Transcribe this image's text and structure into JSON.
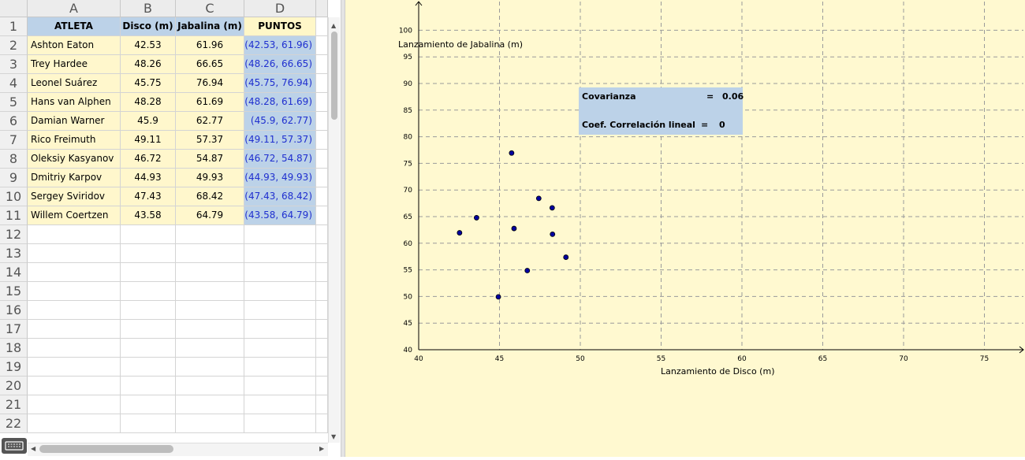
{
  "spreadsheet": {
    "columns": [
      "A",
      "B",
      "C",
      "D"
    ],
    "headers": [
      "ATLETA",
      "Disco (m)",
      "Jabalina (m)",
      "PUNTOS"
    ],
    "row_numbers": [
      "1",
      "2",
      "3",
      "4",
      "5",
      "6",
      "7",
      "8",
      "9",
      "10",
      "11",
      "12",
      "13",
      "14",
      "15",
      "16",
      "17",
      "18",
      "19",
      "20",
      "21",
      "22"
    ],
    "rows": [
      {
        "atleta": "Ashton Eaton",
        "disco": "42.53",
        "jabalina": "61.96",
        "puntos": "(42.53, 61.96)"
      },
      {
        "atleta": "Trey Hardee",
        "disco": "48.26",
        "jabalina": "66.65",
        "puntos": "(48.26, 66.65)"
      },
      {
        "atleta": "Leonel Suárez",
        "disco": "45.75",
        "jabalina": "76.94",
        "puntos": "(45.75, 76.94)"
      },
      {
        "atleta": "Hans van Alphen",
        "disco": "48.28",
        "jabalina": "61.69",
        "puntos": "(48.28, 61.69)"
      },
      {
        "atleta": "Damian Warner",
        "disco": "45.9",
        "jabalina": "62.77",
        "puntos": "(45.9, 62.77)"
      },
      {
        "atleta": "Rico Freimuth",
        "disco": "49.11",
        "jabalina": "57.37",
        "puntos": "(49.11, 57.37)"
      },
      {
        "atleta": "Oleksiy Kasyanov",
        "disco": "46.72",
        "jabalina": "54.87",
        "puntos": "(46.72, 54.87)"
      },
      {
        "atleta": "Dmitriy Karpov",
        "disco": "44.93",
        "jabalina": "49.93",
        "puntos": "(44.93, 49.93)"
      },
      {
        "atleta": "Sergey Sviridov",
        "disco": "47.43",
        "jabalina": "68.42",
        "puntos": "(47.43, 68.42)"
      },
      {
        "atleta": "Willem Coertzen",
        "disco": "43.58",
        "jabalina": "64.79",
        "puntos": "(43.58, 64.79)"
      }
    ]
  },
  "stats": {
    "cov_label": "Covarianza",
    "cov_eq": "=",
    "cov_value": "0.06",
    "corr_label": "Coef. Correlación lineal",
    "corr_eq": "=",
    "corr_value": "0"
  },
  "colors": {
    "point": "#0000a0",
    "header_blue": "#bcd2e8",
    "cell_yellow": "#fff7cc",
    "graph_bg": "#fff9d0"
  },
  "chart_data": {
    "type": "scatter",
    "xlabel": "Lanzamiento de Disco (m)",
    "ylabel": "Lanzamiento de Jabalina (m)",
    "xlim": [
      40,
      78
    ],
    "ylim": [
      40,
      104
    ],
    "x_ticks": [
      40,
      45,
      50,
      55,
      60,
      65,
      70,
      75
    ],
    "y_ticks": [
      40,
      45,
      50,
      55,
      60,
      65,
      70,
      75,
      80,
      85,
      90,
      95,
      100
    ],
    "grid": true,
    "points": [
      {
        "x": 42.53,
        "y": 61.96
      },
      {
        "x": 48.26,
        "y": 66.65
      },
      {
        "x": 45.75,
        "y": 76.94
      },
      {
        "x": 48.28,
        "y": 61.69
      },
      {
        "x": 45.9,
        "y": 62.77
      },
      {
        "x": 49.11,
        "y": 57.37
      },
      {
        "x": 46.72,
        "y": 54.87
      },
      {
        "x": 44.93,
        "y": 49.93
      },
      {
        "x": 47.43,
        "y": 68.42
      },
      {
        "x": 43.58,
        "y": 64.79
      }
    ]
  }
}
